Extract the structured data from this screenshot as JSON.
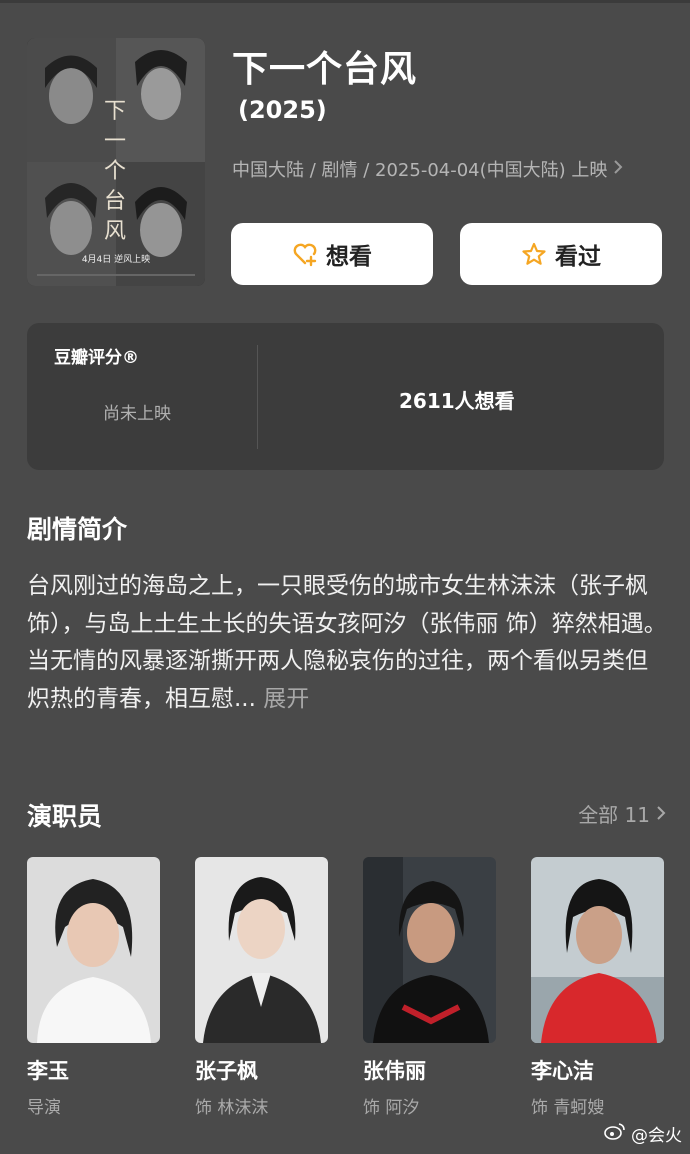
{
  "movie": {
    "title": "下一个台风",
    "year": "(2025)",
    "meta": "中国大陆 / 剧情 / 2025-04-04(中国大陆) 上映",
    "poster": {
      "title_text": "下一个台风",
      "tagline": "4月4日 逆风上映"
    }
  },
  "actions": {
    "want_label": "想看",
    "seen_label": "看过"
  },
  "rating": {
    "label": "豆瓣评分®",
    "status": "尚未上映",
    "want_count": "2611人想看"
  },
  "synopsis": {
    "heading": "剧情简介",
    "text": "台风刚过的海岛之上，一只眼受伤的城市女生林沫沫（张子枫 饰），与岛上土生土长的失语女孩阿汐（张伟丽 饰）猝然相遇。当无情的风暴逐渐撕开两人隐秘哀伤的过往，两个看似另类但炽热的青春，相互慰...",
    "expand_label": "展开"
  },
  "cast": {
    "heading": "演职员",
    "all_label": "全部 11",
    "members": [
      {
        "name": "李玉",
        "role": "导演"
      },
      {
        "name": "张子枫",
        "role": "饰 林沫沫"
      },
      {
        "name": "张伟丽",
        "role": "饰 阿汐"
      },
      {
        "name": "李心洁",
        "role": "饰 青蚵嫂"
      }
    ]
  },
  "watermark": "@会火",
  "colors": {
    "background": "#4a4a4a",
    "card": "#3c3c3c",
    "button": "#ffffff",
    "accent_icon": "#f5a623"
  },
  "icons": [
    "heart-plus-icon",
    "star-icon",
    "chevron-right-icon",
    "weibo-icon"
  ]
}
